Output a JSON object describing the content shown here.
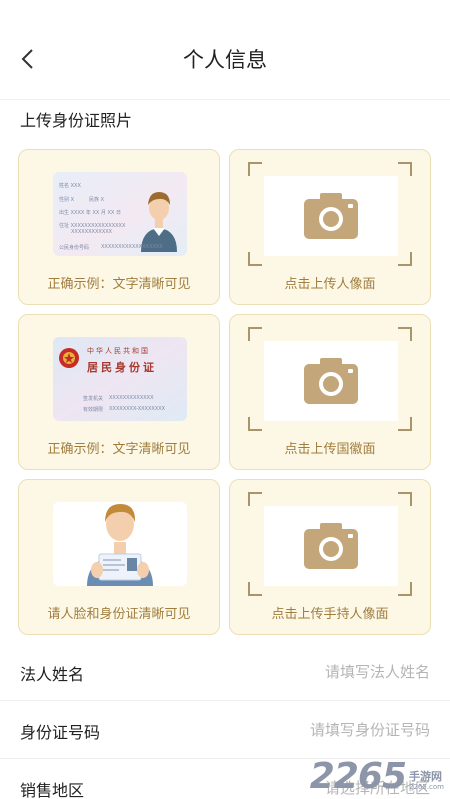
{
  "header": {
    "title": "个人信息"
  },
  "section": {
    "title": "上传身份证照片"
  },
  "cards": {
    "example_front": {
      "caption": "正确示例：文字清晰可见",
      "fields": [
        "姓名 XXX",
        "性别 X",
        "民族 X",
        "出生 XXXX 年 XX 月 XX 日",
        "住址 XXXXXXXXXXXXXXXX",
        "XXXXXXXXXXXX",
        "公民身份号码",
        "XXXXXXXXXXXXXXXXXX"
      ]
    },
    "example_back": {
      "caption": "正确示例：文字清晰可见",
      "country": "中华人民共和国",
      "card_name": "居民身份证",
      "issuer_label": "签发机关",
      "issuer_value": "XXXXXXXXXXXXX",
      "validity_label": "有效期限",
      "validity_value": "XXXXXXXX-XXXXXXXX"
    },
    "example_hold": {
      "caption": "请人脸和身份证清晰可见"
    },
    "upload_portrait": {
      "caption": "点击上传人像面"
    },
    "upload_emblem": {
      "caption": "点击上传国徽面"
    },
    "upload_hold": {
      "caption": "点击上传手持人像面"
    }
  },
  "form": {
    "name": {
      "label": "法人姓名",
      "placeholder": "请填写法人姓名"
    },
    "id": {
      "label": "身份证号码",
      "placeholder": "请填写身份证号码"
    },
    "region": {
      "label": "销售地区",
      "placeholder": "请选择所在地区"
    }
  },
  "watermark": {
    "number": "2265",
    "text": "手游网",
    "url": "2265.com"
  },
  "colors": {
    "accent": "#a07d3e",
    "card_bg": "#fdf8e6",
    "card_border": "#ecdfb6",
    "camera": "#c3a77b"
  },
  "icons": {
    "back": "chevron-left-icon",
    "camera": "camera-icon"
  }
}
